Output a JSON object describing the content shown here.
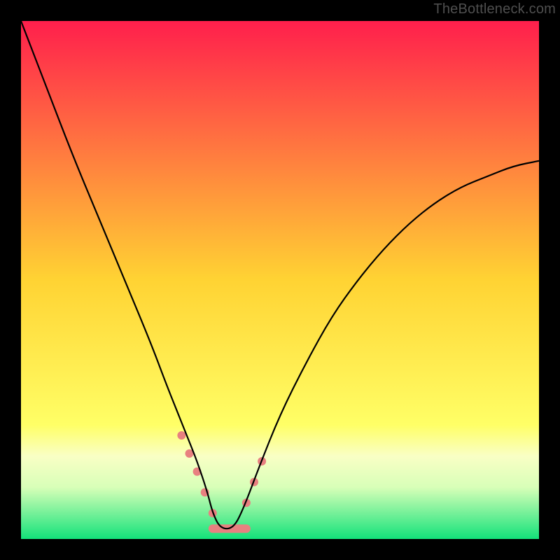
{
  "watermark": "TheBottleneck.com",
  "chart_data": {
    "type": "line",
    "title": "",
    "xlabel": "",
    "ylabel": "",
    "xlim": [
      0,
      100
    ],
    "ylim": [
      0,
      100
    ],
    "grid": false,
    "legend": false,
    "background_gradient": [
      {
        "pos": 0.0,
        "color": "#ff1f4c"
      },
      {
        "pos": 0.5,
        "color": "#ffd333"
      },
      {
        "pos": 0.78,
        "color": "#ffff66"
      },
      {
        "pos": 0.84,
        "color": "#f9ffc5"
      },
      {
        "pos": 0.9,
        "color": "#d8ffb8"
      },
      {
        "pos": 1.0,
        "color": "#13e27a"
      }
    ],
    "series": [
      {
        "name": "bottleneck-curve",
        "stroke": "#000000",
        "x": [
          0,
          5,
          10,
          15,
          20,
          25,
          28,
          30,
          32,
          34,
          36,
          37,
          38.5,
          41,
          43,
          46,
          50,
          55,
          60,
          65,
          70,
          75,
          80,
          85,
          90,
          95,
          100
        ],
        "values": [
          100,
          87,
          74,
          62,
          50,
          38,
          30,
          25,
          20,
          15,
          9,
          5,
          2,
          2,
          6,
          14,
          24,
          34,
          43,
          50,
          56,
          61,
          65,
          68,
          70,
          72,
          73
        ]
      }
    ],
    "markers": {
      "color": "#e88080",
      "radius_px": 6,
      "points": [
        {
          "x": 31.0,
          "y": 20.0
        },
        {
          "x": 32.5,
          "y": 16.5
        },
        {
          "x": 34.0,
          "y": 13.0
        },
        {
          "x": 35.5,
          "y": 9.0
        },
        {
          "x": 37.0,
          "y": 5.0
        },
        {
          "x": 43.5,
          "y": 7.0
        },
        {
          "x": 45.0,
          "y": 11.0
        },
        {
          "x": 46.5,
          "y": 15.0
        }
      ],
      "flat_segment": {
        "x0": 37.0,
        "x1": 43.5,
        "y": 2.0,
        "stroke_px": 12
      }
    }
  }
}
